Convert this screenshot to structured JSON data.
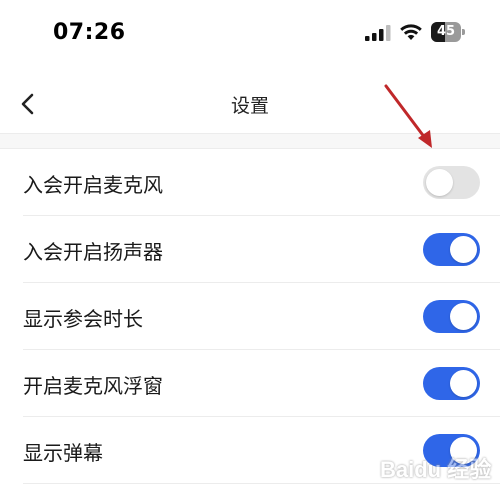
{
  "status_bar": {
    "time": "07:26",
    "battery_level": "45",
    "icons": [
      "signal-icon",
      "wifi-icon",
      "battery-icon"
    ]
  },
  "nav": {
    "title": "设置",
    "back_icon": "chevron-left-icon"
  },
  "settings": [
    {
      "label": "入会开启麦克风",
      "enabled": false
    },
    {
      "label": "入会开启扬声器",
      "enabled": true
    },
    {
      "label": "显示参会时长",
      "enabled": true
    },
    {
      "label": "开启麦克风浮窗",
      "enabled": true
    },
    {
      "label": "显示弹幕",
      "enabled": true
    }
  ],
  "colors": {
    "toggle_on": "#2f66e8",
    "toggle_off": "#e3e3e3",
    "annotation_arrow": "#c0282a"
  },
  "watermark": {
    "text": "Baidu 经验"
  }
}
